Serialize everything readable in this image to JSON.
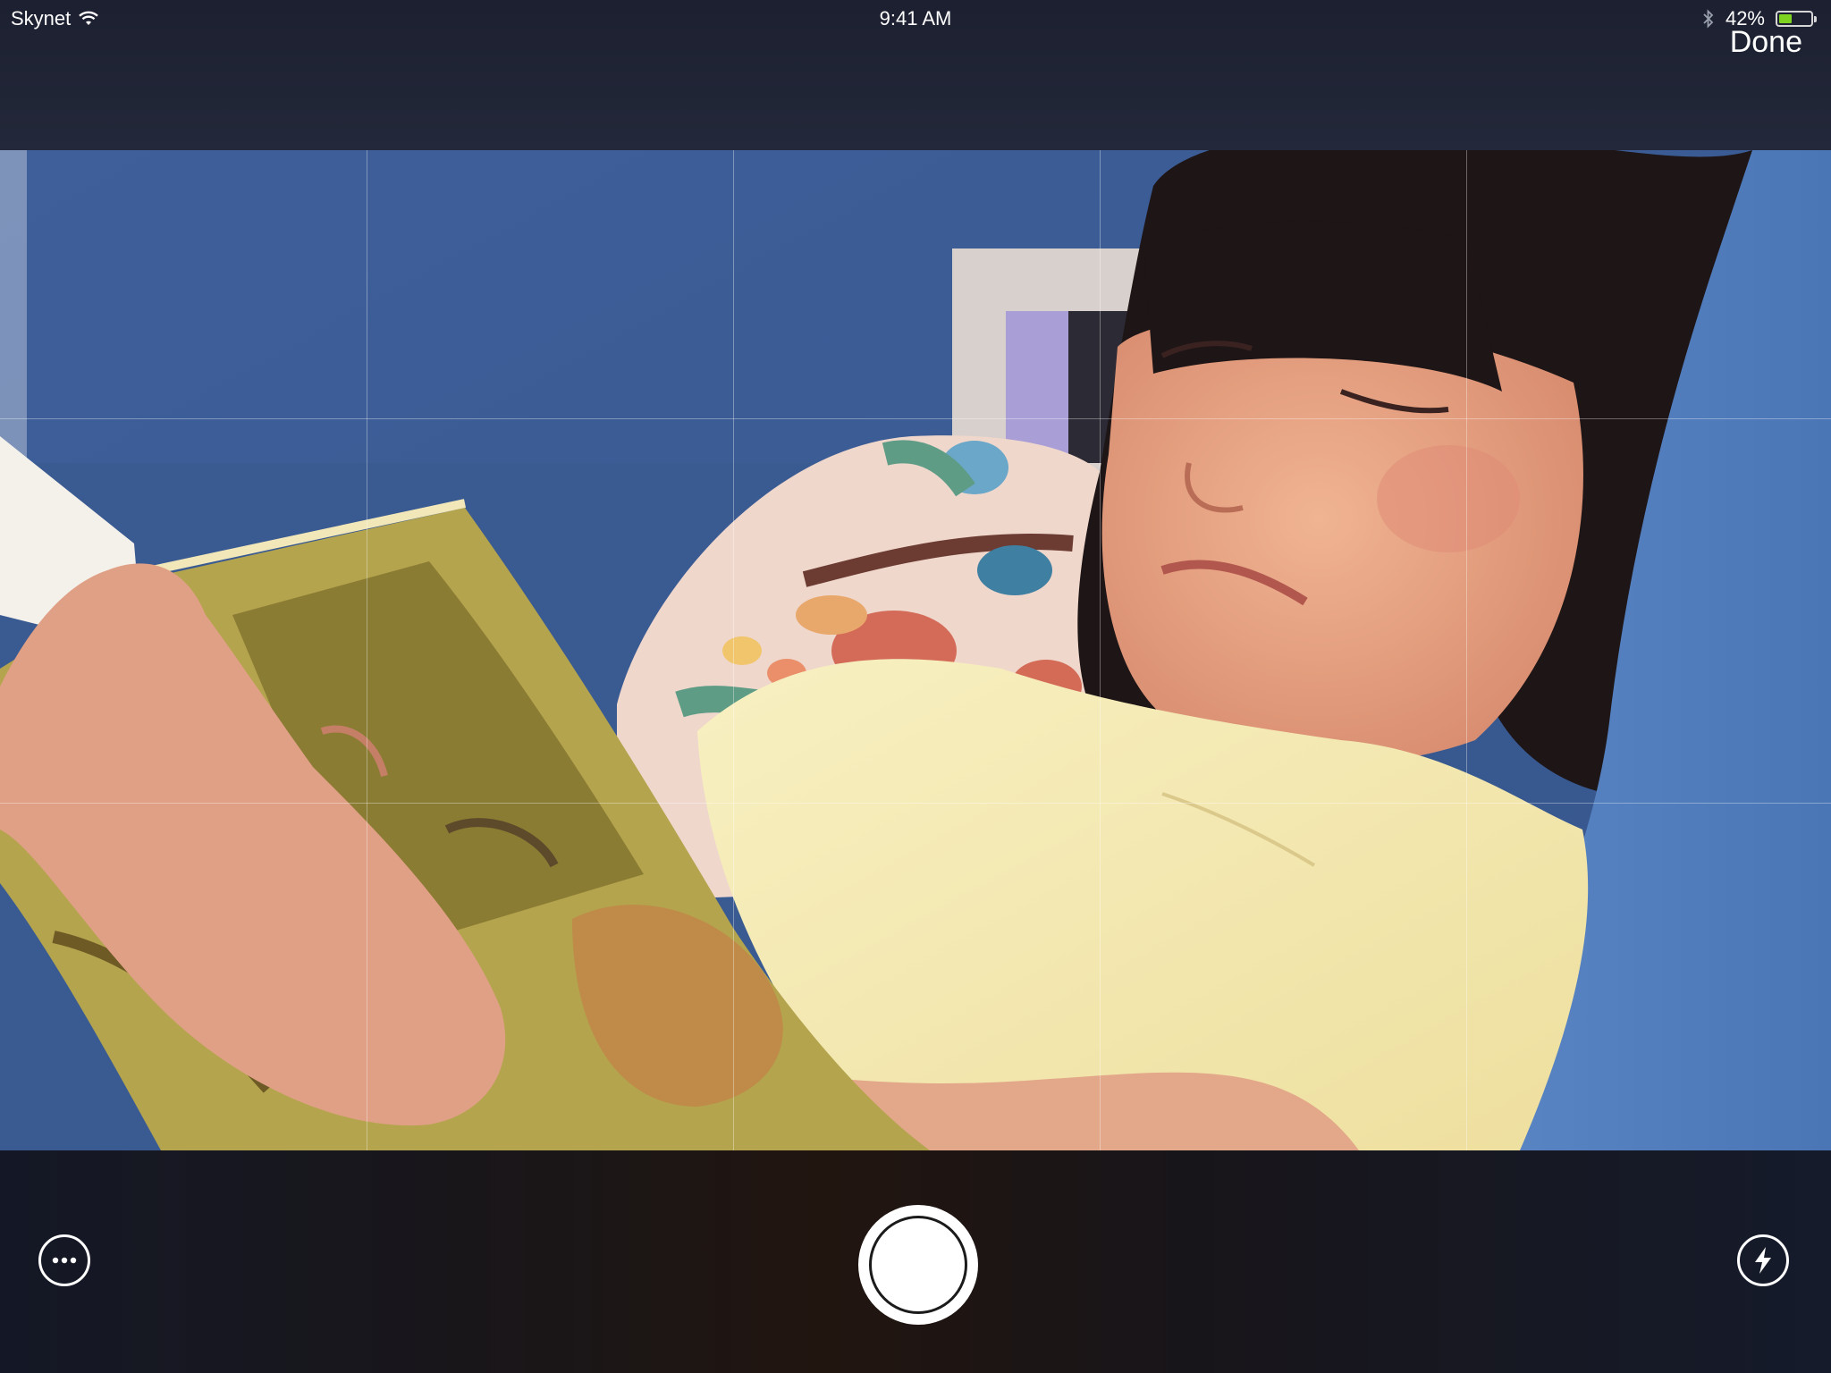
{
  "status_bar": {
    "carrier": "Skynet",
    "time": "9:41 AM",
    "battery_percent": "42%",
    "battery_level": 0.42,
    "icons": [
      "wifi-icon",
      "bluetooth-icon",
      "battery-icon"
    ]
  },
  "header": {
    "done_label": "Done"
  },
  "camera": {
    "grid": "3x5",
    "controls": {
      "more": "more-options-icon",
      "shutter": "shutter-button",
      "flash": "flash-icon"
    }
  },
  "colors": {
    "bar_background": "#1d2030",
    "battery_fill": "#7ed321",
    "icon": "#ffffff"
  }
}
